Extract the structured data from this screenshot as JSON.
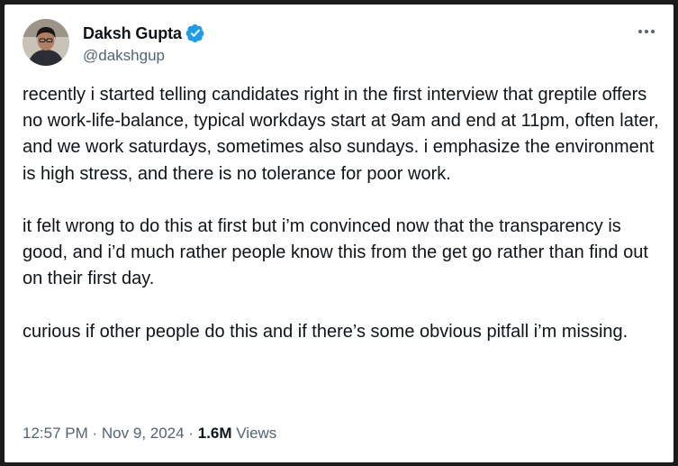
{
  "author": {
    "display_name": "Daksh Gupta",
    "handle": "@dakshgup",
    "verified": true,
    "verified_color": "#1d9bf0"
  },
  "tweet": {
    "paragraphs": [
      "recently i started telling candidates right in the first interview that greptile offers no work-life-balance, typical workdays start at 9am and end at 11pm, often later, and we work saturdays, sometimes also sundays. i emphasize the environment is high stress, and there is no tolerance for poor work.",
      "it felt wrong to do this at first but i’m convinced now that the transparency is good, and i’d much rather people know this from the get go rather than find out on their first day.",
      "curious if other people do this and if there’s some obvious pitfall i’m missing."
    ],
    "time": "12:57 PM",
    "separator": "·",
    "date": "Nov 9, 2024",
    "views_count": "1.6M",
    "views_label": "Views"
  },
  "icons": {
    "more": "more-horizontal-icon",
    "verified": "verified-badge-icon"
  },
  "colors": {
    "text_primary": "#0f1419",
    "text_secondary": "#536471",
    "background": "#ffffff",
    "frame": "#1b1b1b"
  }
}
